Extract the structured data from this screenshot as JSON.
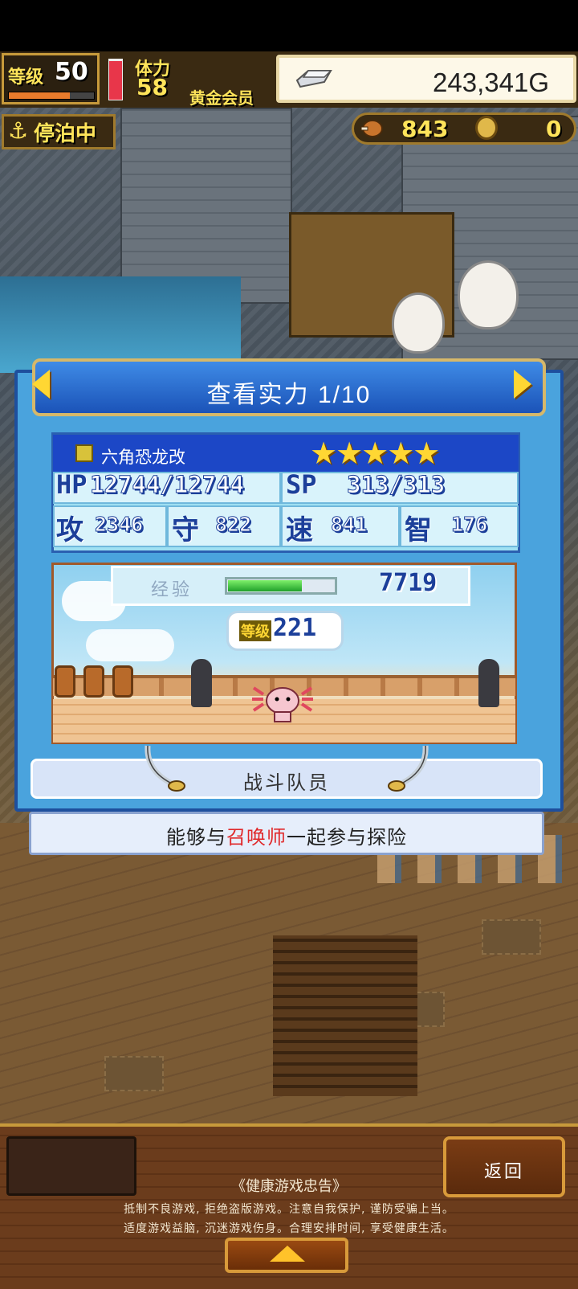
{
  "hud": {
    "level_label": "等级",
    "level_value": "50",
    "level_progress": 0.72,
    "stamina_label": "体力",
    "stamina_value": "58",
    "member_badge": "黄金会员",
    "gold_value": "243,341G",
    "docked_label": "停泊中",
    "food_value": "843",
    "coin_value": "0"
  },
  "panel": {
    "title": "查看实力 1/10",
    "character": {
      "name": "六角恐龙改",
      "stars": "★★★★★",
      "hp_label": "HP",
      "hp_value": "12744/12744",
      "sp_label": "SP",
      "sp_value": "313/313",
      "atk_label": "攻",
      "atk_value": "2346",
      "def_label": "守",
      "def_value": "822",
      "spd_label": "速",
      "spd_value": "841",
      "int_label": "智",
      "int_value": "176"
    },
    "exp_label": "经验",
    "exp_progress": 0.7,
    "exp_value": "7719",
    "unit_level_label": "等级",
    "unit_level_value": "221",
    "role_label": "战斗队员",
    "description_prefix": "能够与",
    "description_highlight": "召唤师",
    "description_suffix": "一起参与探险"
  },
  "footer": {
    "back_label": "返回",
    "notice_title": "《健康游戏忠告》",
    "notice_line1": "抵制不良游戏, 拒绝盗版游戏。注意自我保护, 谨防受骗上当。",
    "notice_line2": "适度游戏益脑, 沉迷游戏伤身。合理安排时间, 享受健康生活。"
  },
  "colors": {
    "panel_blue": "#4aa3dd",
    "header_blue": "#1b53b8",
    "accent_gold": "#ffd733",
    "highlight_red": "#e0282a"
  }
}
